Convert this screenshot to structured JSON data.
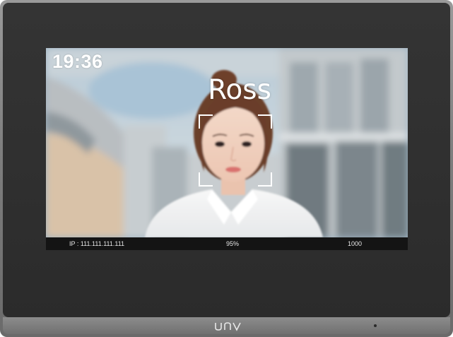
{
  "device": {
    "brand_logo": "UNV",
    "body_color": "#2f2f2f",
    "frame_color": "#808080",
    "indicator_icon": "indicator-dot-icon"
  },
  "screen": {
    "clock": "19:36",
    "recognized_name": "Ross",
    "face_frame_icon": "face-detection-frame-icon",
    "frame_color": "#ffffff"
  },
  "status_bar": {
    "ip": "IP : 111.111.111.111",
    "match_score": "95%",
    "count": "1000"
  }
}
